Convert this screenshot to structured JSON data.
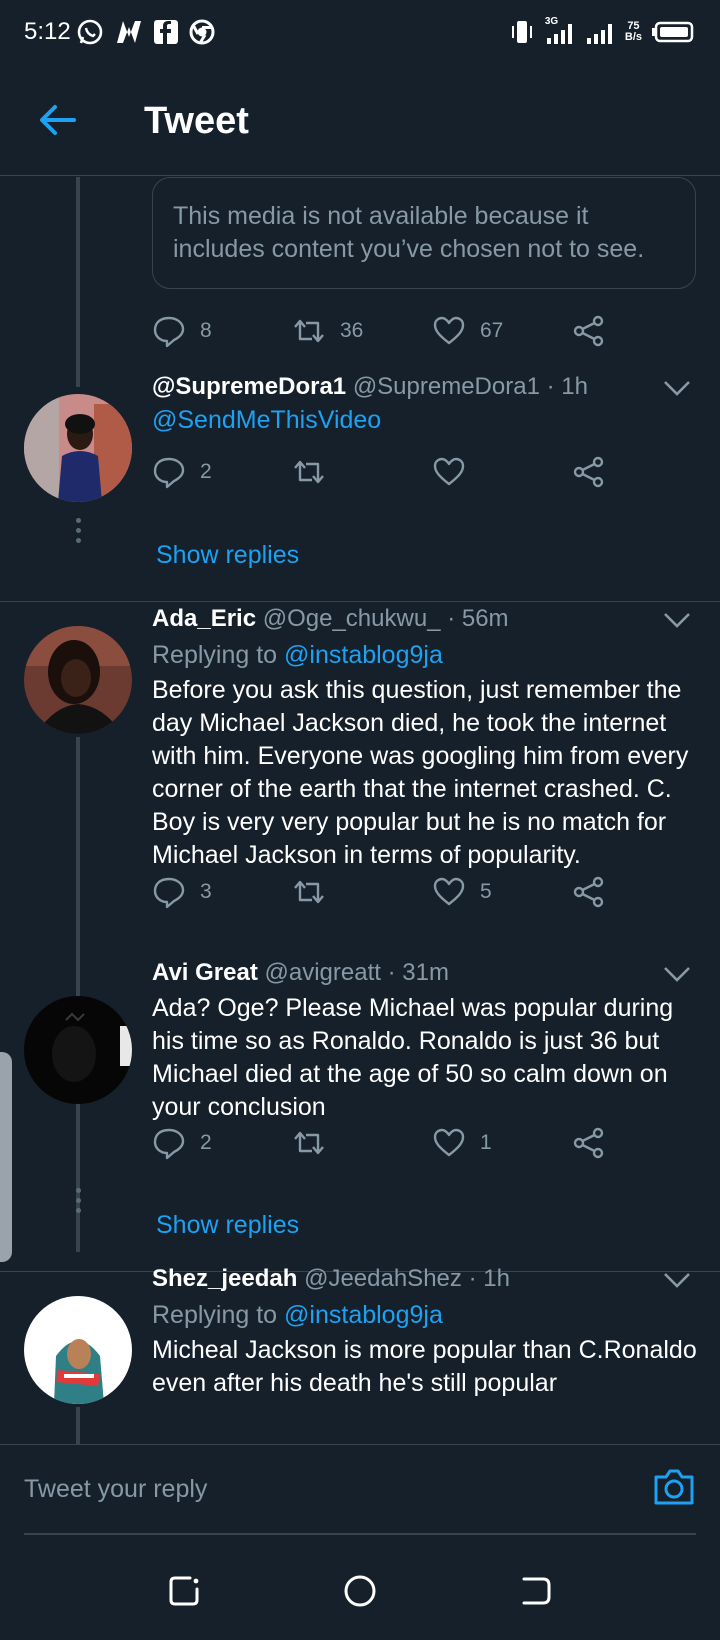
{
  "status_bar": {
    "time": "5:12",
    "network": "3G",
    "speed_value": "75",
    "speed_unit": "B/s"
  },
  "app_bar": {
    "title": "Tweet"
  },
  "media_notice": "This media is not available because it includes content you’ve chosen not to see.",
  "first_actions": {
    "replies": "8",
    "retweets": "36",
    "likes": "67"
  },
  "tweets": [
    {
      "name": "@SupremeDora1",
      "handle": "@SupremeDora1",
      "time": "· 1h",
      "text": "@SendMeThisVideo",
      "replies": "2",
      "retweets": "",
      "likes": "",
      "show_replies": "Show replies"
    },
    {
      "name": "Ada_Eric",
      "handle": "@Oge_chukwu_",
      "time": "· 56m",
      "replying_prefix": "Replying to",
      "replying_to": "@instablog9ja",
      "text": "Before you ask this question, just remember the day Michael Jackson died, he took the internet with him. Everyone was googling him from every corner of the earth that the internet crashed. C. Boy is very very popular but he is no match for Michael Jackson in terms of popularity.",
      "replies": "3",
      "retweets": "",
      "likes": "5"
    },
    {
      "name": "Avi Great",
      "handle": "@avigreatt",
      "time": "· 31m",
      "text": "Ada? Oge? Please Michael was popular during his time so as Ronaldo. Ronaldo is just 36 but Michael died at the age of 50 so calm down on your conclusion",
      "replies": "2",
      "retweets": "",
      "likes": "1",
      "show_replies": "Show replies"
    },
    {
      "name": "Shez_jeedah",
      "handle": "@JeedahShez",
      "time": "· 1h",
      "replying_prefix": "Replying to",
      "replying_to": "@instablog9ja",
      "text": "Micheal Jackson is more popular than C.Ronaldo even after his death he's still popular"
    }
  ],
  "reply_bar": {
    "placeholder": "Tweet your reply"
  },
  "colors": {
    "background": "#15202b",
    "accent": "#1da1f2",
    "secondary_text": "#8899a6",
    "divider": "#38444d"
  }
}
